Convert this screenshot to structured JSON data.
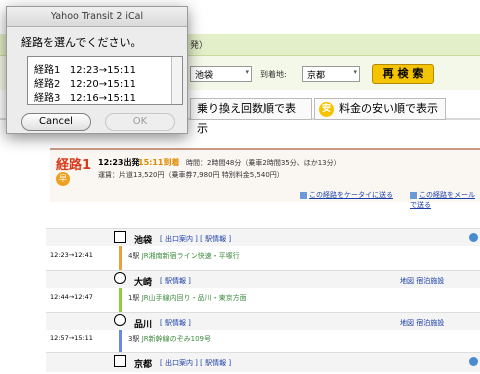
{
  "dialog": {
    "title": "Yahoo Transit 2 iCal",
    "prompt": "経路を選んでください。",
    "routes": [
      {
        "label": "経路1",
        "time": "12:23→15:11"
      },
      {
        "label": "経路2",
        "time": "12:20→15:11"
      },
      {
        "label": "経路3",
        "time": "12:16→15:11"
      }
    ],
    "cancel_label": "Cancel",
    "ok_label": "OK"
  },
  "search": {
    "heading_fragment": "発）",
    "from_value": "池袋",
    "to_label": "到着地:",
    "to_value": "京都",
    "research_label": "再 検 索"
  },
  "tabs": {
    "transfers_label": "乗り換え回数順で表示",
    "fare_icon": "安",
    "fare_label": "料金の安い順で表示"
  },
  "route": {
    "name": "経路1",
    "badge": "早",
    "depart": "12:23出発",
    "arrive": "15:11到着",
    "duration": "時間：2時間48分（乗車2時間35分、ほか13分）",
    "fare": "運賃：片道13,520円（乗車券7,980円 特別料金5,540円）",
    "share_mobile": "この経路をケータイに送る",
    "share_mail": "この経路をメールで送る"
  },
  "stations": [
    {
      "name": "池袋",
      "links": "[ 出口案内 ] [ 駅情報 ]"
    },
    {
      "name": "大崎",
      "links": "[ 駅情報 ]",
      "map": "地図",
      "hotel": "宿泊施設"
    },
    {
      "name": "品川",
      "links": "[ 駅情報 ]",
      "map": "地図",
      "hotel": "宿泊施設"
    },
    {
      "name": "京都",
      "links": "[ 出口案内 ] [ 駅情報 ]"
    }
  ],
  "segments": [
    {
      "time": "12:23→12:41",
      "stops": "4駅",
      "line": "JR湘南新宿ライン快速・平塚行",
      "color": "#e8a040"
    },
    {
      "time": "12:44→12:47",
      "stops": "1駅",
      "line": "JR山手線内回り・品川・東京方面",
      "color": "#8ccf3a"
    },
    {
      "time": "12:57→15:11",
      "stops": "3駅",
      "line": "JR新幹線のぞみ109号",
      "color": "#6a8ae0"
    }
  ]
}
